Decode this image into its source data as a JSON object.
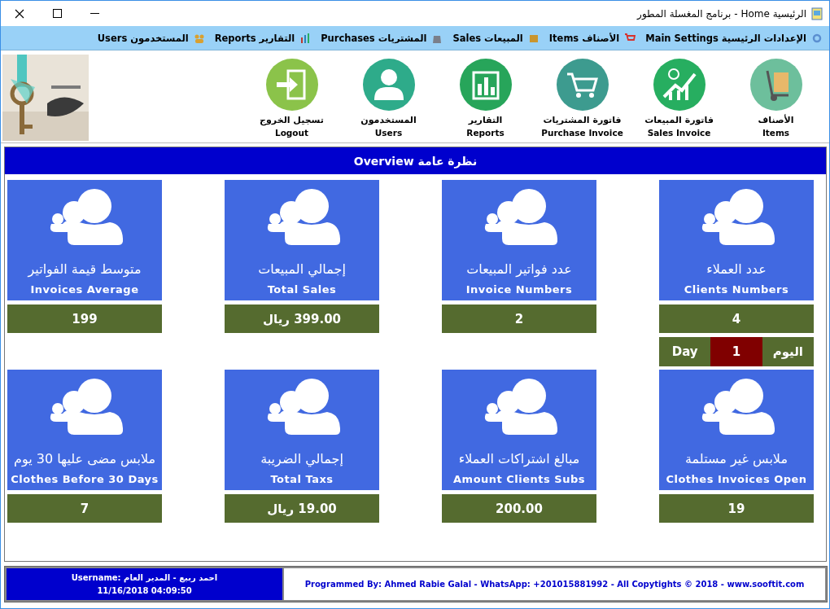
{
  "window": {
    "title": "الرئيسية Home - برنامج المغسلة المطور"
  },
  "menu": [
    {
      "label": "الإعدادات الرئيسية Main Settings"
    },
    {
      "label": "الأصناف Items"
    },
    {
      "label": "المبيعات Sales"
    },
    {
      "label": "المشتريات Purchases"
    },
    {
      "label": "التقارير Reports"
    },
    {
      "label": "المستخدمون Users"
    }
  ],
  "toolbar": [
    {
      "arabic": "الأصناف",
      "english": "Items"
    },
    {
      "arabic": "فاتورة المبيعات",
      "english": "Sales Invoice"
    },
    {
      "arabic": "فاتورة المشتريات",
      "english": "Purchase Invoice"
    },
    {
      "arabic": "التقارير",
      "english": "Reports"
    },
    {
      "arabic": "المستخدمون",
      "english": "Users"
    },
    {
      "arabic": "تسجيل الخروج",
      "english": "Logout"
    }
  ],
  "overview": {
    "title": "نظرة عامة Overview",
    "stats": [
      {
        "arabic": "عدد العملاء",
        "english": "Clients Numbers",
        "value": "4"
      },
      {
        "arabic": "عدد فواتير المبيعات",
        "english": "Invoice Numbers",
        "value": "2"
      },
      {
        "arabic": "إجمالي المبيعات",
        "english": "Total Sales",
        "value": "399.00 ريال"
      },
      {
        "arabic": "متوسط قيمة الفواتير",
        "english": "Invoices Average",
        "value": "199"
      },
      {
        "arabic": "ملابس غير مستلمة",
        "english": "Clothes Invoices Open",
        "value": "19"
      },
      {
        "arabic": "مبالغ اشتراكات العملاء",
        "english": "Amount Clients Subs",
        "value": "200.00"
      },
      {
        "arabic": "إجمالي الضريبة",
        "english": "Total Taxs",
        "value": "19.00 ريال"
      },
      {
        "arabic": "ملابس مضى عليها 30 يوم",
        "english": "Clothes Before 30 Days",
        "value": "7"
      }
    ],
    "day": {
      "arabic": "اليوم",
      "value": "1",
      "english": "Day"
    }
  },
  "footer": {
    "username": "Username: احمد ربيع - المدير العام",
    "datetime": "11/16/2018 04:09:50",
    "credits": "Programmed By: Ahmed Rabie Galal - WhatsApp: +201015881992 - All Copytights © 2018 - www.sooftit.com"
  }
}
